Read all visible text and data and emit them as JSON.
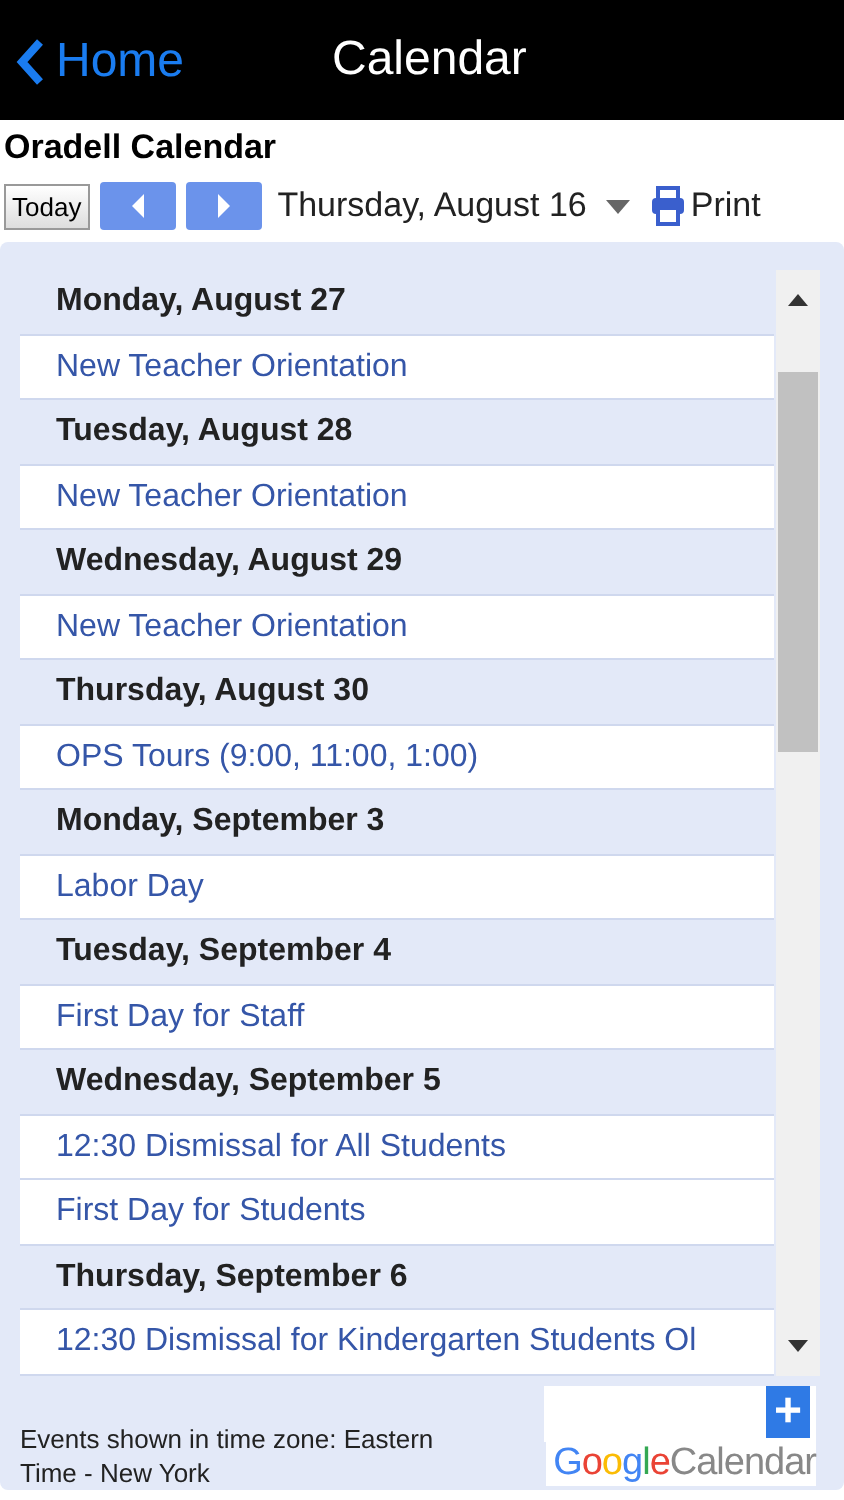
{
  "nav": {
    "back": "Home",
    "title": "Calendar"
  },
  "calendar_title": "Oradell Calendar",
  "toolbar": {
    "today": "Today",
    "date": "Thursday, August 16",
    "print": "Print"
  },
  "agenda": [
    {
      "date": "Monday, August 27",
      "events": [
        "New Teacher Orientation"
      ]
    },
    {
      "date": "Tuesday, August 28",
      "events": [
        "New Teacher Orientation"
      ]
    },
    {
      "date": "Wednesday, August 29",
      "events": [
        "New Teacher Orientation"
      ]
    },
    {
      "date": "Thursday, August 30",
      "events": [
        "OPS Tours (9:00, 11:00, 1:00)"
      ]
    },
    {
      "date": "Monday, September 3",
      "events": [
        "Labor Day"
      ]
    },
    {
      "date": "Tuesday, September 4",
      "events": [
        "First Day for Staff"
      ]
    },
    {
      "date": "Wednesday, September 5",
      "events": [
        "12:30 Dismissal for All Students",
        "First Day for Students"
      ]
    },
    {
      "date": "Thursday, September 6",
      "events": [
        "12:30 Dismissal for Kindergarten Students Ol"
      ]
    }
  ],
  "footer": {
    "timezone": "Events shown in time zone: Eastern Time - New York",
    "logo_brand": "Google",
    "logo_product": "Calendar",
    "add": "+"
  }
}
